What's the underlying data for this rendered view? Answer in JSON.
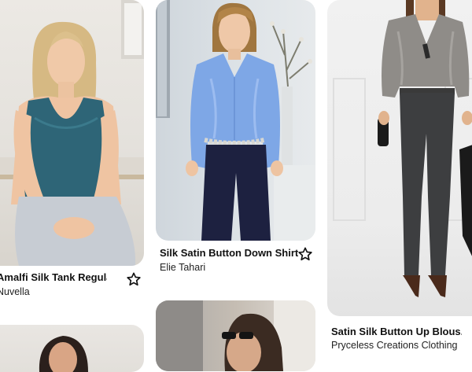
{
  "pins": [
    {
      "title": "Amalfi Silk Tank Regular...",
      "source": "Nuvella",
      "image_alt": "teal silk tank top outfit"
    },
    {
      "title": "Silk Satin Button Down Shirt",
      "source": "Elie Tahari",
      "image_alt": "blue silk satin button down shirt outfit"
    },
    {
      "title": "Satin Silk Button Up Blous...",
      "source": "Pryceless Creations Clothing",
      "image_alt": "gray satin silk blouse outfit"
    }
  ],
  "colors": {
    "teal_top": "#2e6577",
    "blue_shirt": "#7ea7e6",
    "gray_blouse": "#8f8c88"
  },
  "icons": {
    "save": "star-outline-icon"
  }
}
